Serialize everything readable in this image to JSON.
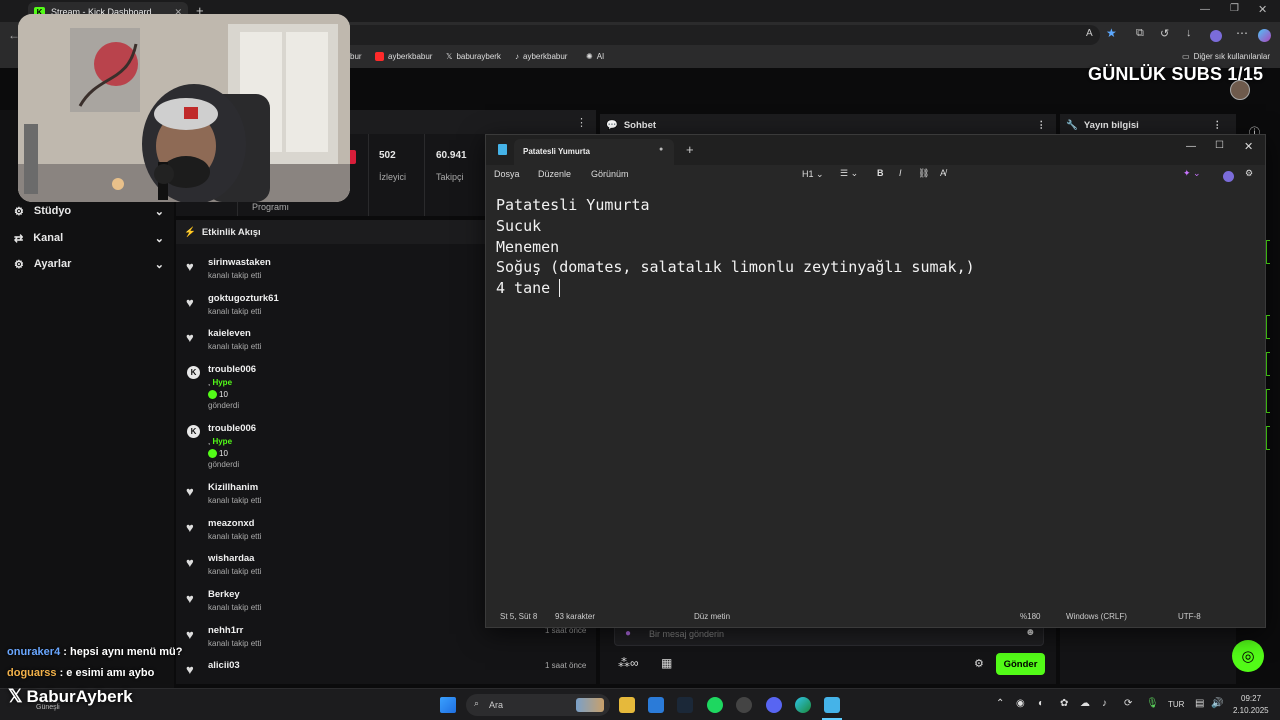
{
  "browser": {
    "tab_title": "Stream - Kick Dashboard",
    "bookmarks": [
      "bur",
      "ayberkbabur",
      "baburayberk",
      "ayberkbabur",
      "AI"
    ],
    "bookmarks_other": "Diğer sık kullanılanlar"
  },
  "overlay": {
    "subs_goal": "GÜNLÜK SUBS 1/15",
    "chat": [
      {
        "user": "onuraker4",
        "text": " : hepsi aynı menü mü?",
        "color": "#6aa7ff"
      },
      {
        "user": "doguarss",
        "text": " : e esimi amı aybo",
        "color": "#f3b24a"
      }
    ],
    "brand": "BaburAyberk",
    "weather": "Güneşli"
  },
  "sidebar": {
    "items": [
      {
        "label": "Stüdyo"
      },
      {
        "label": "Kanal"
      },
      {
        "label": "Ayarlar"
      }
    ]
  },
  "stats": {
    "program_label": "Programı",
    "viewers_value": "502",
    "viewers_label": "İzleyici",
    "followers_value": "60.941",
    "followers_label": "Takipçi"
  },
  "activity": {
    "title": "Etkinlik Akışı",
    "items": [
      {
        "name": "sirinwastaken",
        "sub": "kanalı takip etti",
        "type": "follow"
      },
      {
        "name": "goktugozturk61",
        "sub": "kanalı takip etti",
        "type": "follow"
      },
      {
        "name": "kaieleven",
        "sub": "kanalı takip etti",
        "type": "follow"
      },
      {
        "name": "trouble006",
        "hype_prefix": ", ",
        "hype": "Hype",
        "amount": "10",
        "sub": "gönderdi",
        "type": "kicks"
      },
      {
        "name": "trouble006",
        "hype_prefix": ", ",
        "hype": "Hype",
        "amount": "10",
        "sub": "gönderdi",
        "type": "kicks"
      },
      {
        "name": "Kizillhanim",
        "sub": "kanalı takip etti",
        "type": "follow"
      },
      {
        "name": "meazonxd",
        "sub": "kanalı takip etti",
        "type": "follow"
      },
      {
        "name": "wishardaa",
        "sub": "kanalı takip etti",
        "type": "follow"
      },
      {
        "name": "Berkey",
        "sub": "kanalı takip etti",
        "type": "follow"
      },
      {
        "name": "nehh1rr",
        "sub": "kanalı takip etti",
        "time": "1 saat önce",
        "type": "follow"
      },
      {
        "name": "alicii03",
        "sub": "",
        "time": "1 saat önce",
        "type": "follow"
      }
    ]
  },
  "chat_panel": {
    "title": "Sohbet",
    "placeholder": "Bir mesaj gönderin",
    "send_label": "Gönder"
  },
  "stream_info": {
    "title": "Yayın bilgisi"
  },
  "notepad": {
    "tab_title": "Patatesli Yumurta",
    "menu": [
      "Dosya",
      "Düzenle",
      "Görünüm"
    ],
    "heading_selector": "H1",
    "lines": [
      "Patatesli Yumurta",
      "Sucuk",
      "Menemen",
      "Soğuş (domates, salatalık limonlu zeytinyağlı sumak,)",
      "4 tane "
    ],
    "status": {
      "position": "St 5, Süt 8",
      "chars": "93 karakter",
      "format": "Düz metin",
      "zoom": "%180",
      "line_ending": "Windows (CRLF)",
      "encoding": "UTF-8"
    }
  },
  "taskbar": {
    "search_label": "Ara",
    "language": "TUR",
    "time": "09:27",
    "date": "2.10.2025"
  }
}
